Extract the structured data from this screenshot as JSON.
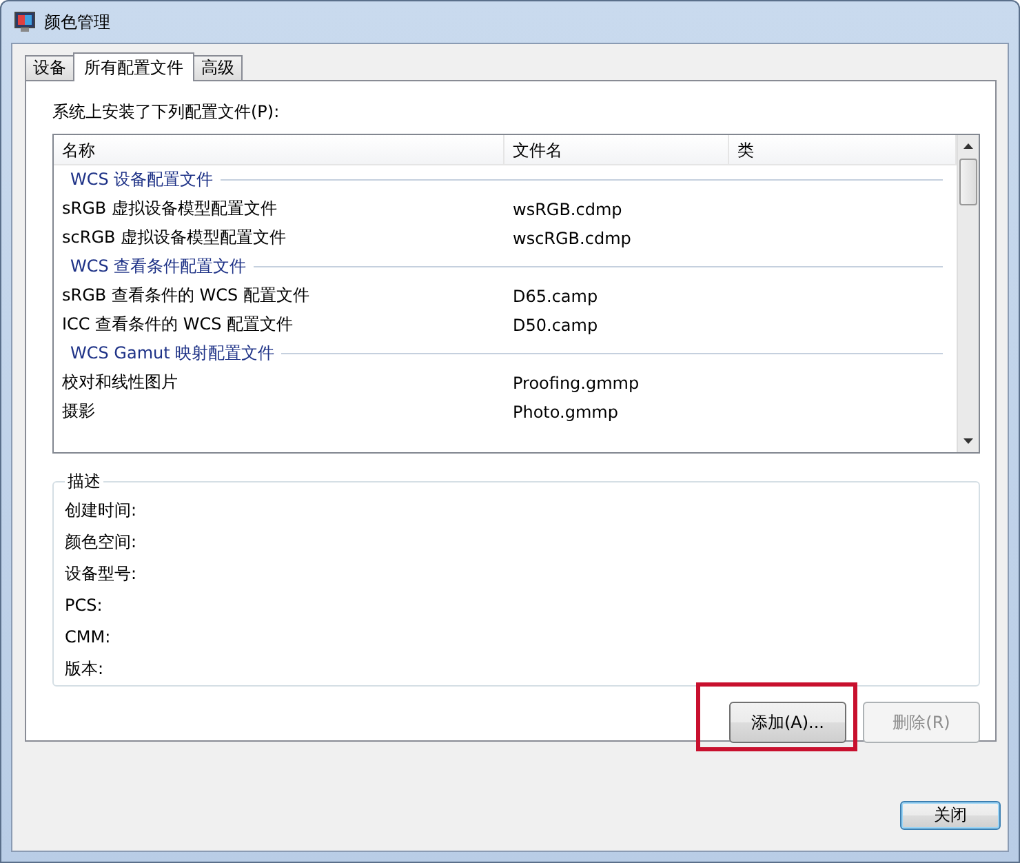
{
  "window": {
    "title": "颜色管理"
  },
  "tabs": [
    {
      "label": "设备",
      "selected": false
    },
    {
      "label": "所有配置文件",
      "selected": true
    },
    {
      "label": "高级",
      "selected": false
    }
  ],
  "list_label": "系统上安装了下列配置文件(P):",
  "table": {
    "columns": [
      "名称",
      "文件名",
      "类"
    ],
    "groups": [
      {
        "label": "WCS 设备配置文件",
        "rows": [
          {
            "name": "sRGB 虚拟设备模型配置文件",
            "file": "wsRGB.cdmp"
          },
          {
            "name": "scRGB 虚拟设备模型配置文件",
            "file": "wscRGB.cdmp"
          }
        ]
      },
      {
        "label": "WCS 查看条件配置文件",
        "rows": [
          {
            "name": "sRGB 查看条件的 WCS 配置文件",
            "file": "D65.camp"
          },
          {
            "name": "ICC 查看条件的 WCS 配置文件",
            "file": "D50.camp"
          }
        ]
      },
      {
        "label": "WCS Gamut 映射配置文件",
        "rows": [
          {
            "name": "校对和线性图片",
            "file": "Proofing.gmmp"
          },
          {
            "name": "摄影",
            "file": "Photo.gmmp"
          }
        ]
      }
    ]
  },
  "description": {
    "title": "描述",
    "fields": [
      "创建时间:",
      "颜色空间:",
      "设备型号:",
      "PCS:",
      "CMM:",
      "版本:"
    ]
  },
  "buttons": [
    {
      "label": "添加(A)...",
      "disabled": false,
      "highlighted": true
    },
    {
      "label": "删除(R)",
      "disabled": true,
      "highlighted": false
    }
  ],
  "close_button": {
    "label": "关闭",
    "default": true
  }
}
